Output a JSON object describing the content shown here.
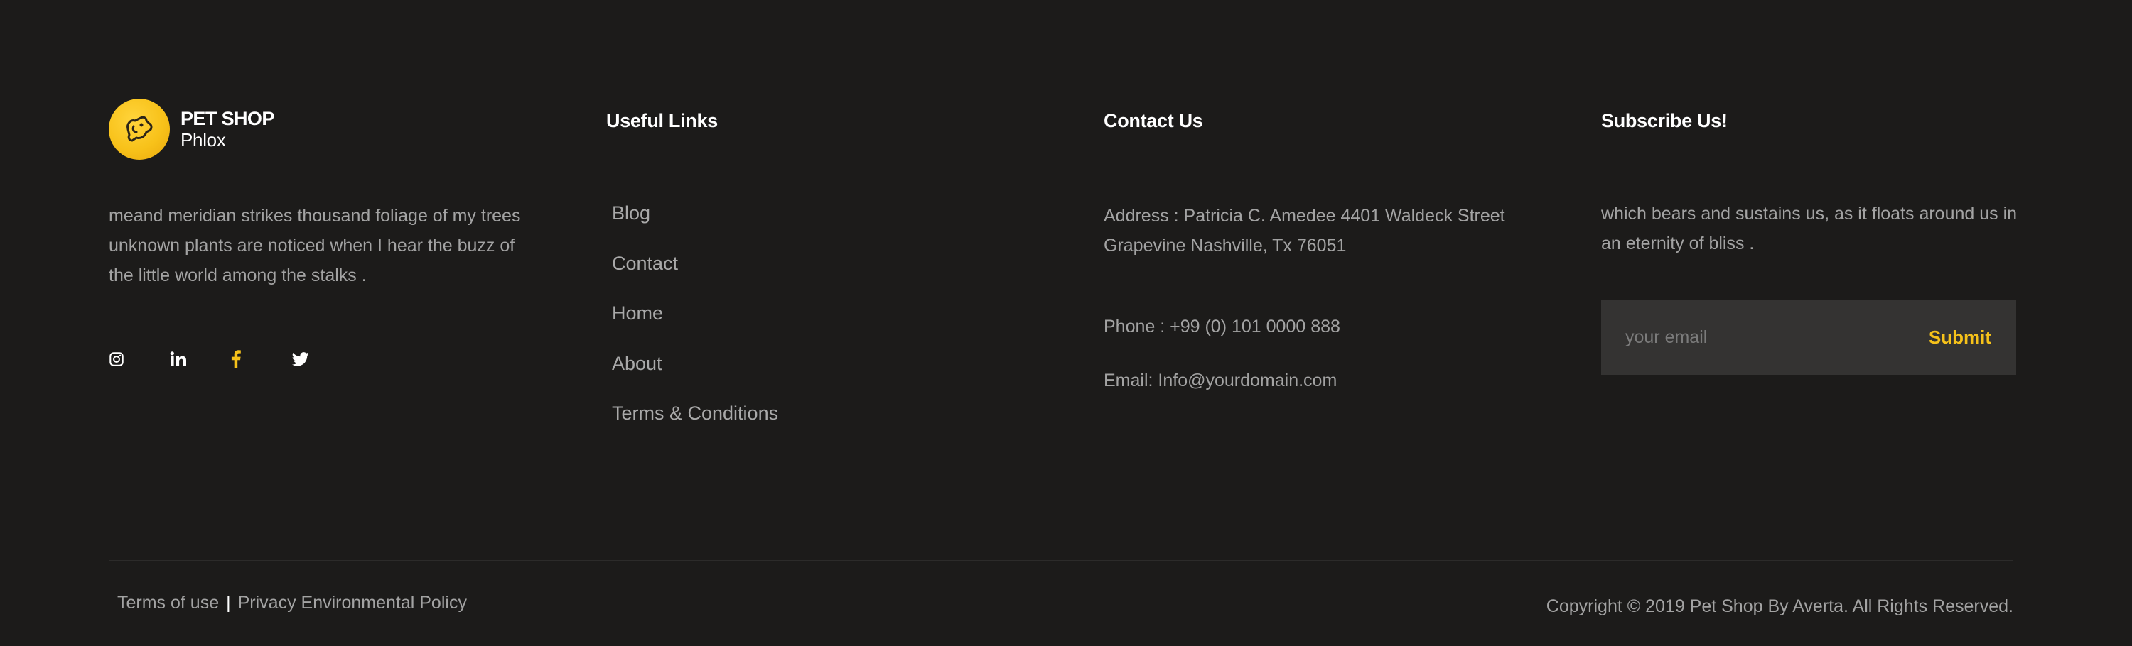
{
  "brand": {
    "title": "PET SHOP",
    "subtitle": "Phlox",
    "about": "meand meridian strikes thousand foliage of my trees unknown plants are noticed when I hear the buzz of the little world among the stalks .",
    "socials": [
      {
        "icon": "instagram-icon",
        "color": "#ffffff"
      },
      {
        "icon": "linkedin-icon",
        "color": "#ffffff"
      },
      {
        "icon": "facebook-icon",
        "color": "#f6c21a"
      },
      {
        "icon": "twitter-icon",
        "color": "#ffffff"
      }
    ],
    "logo_color": "#f8c21a"
  },
  "useful_links": {
    "heading": "Useful Links",
    "items": [
      "Blog",
      "Contact",
      "Home",
      "About",
      "Terms & Conditions"
    ]
  },
  "contact": {
    "heading": "Contact Us",
    "address": "Address : Patricia C. Amedee 4401 Waldeck Street Grapevine Nashville, Tx 76051",
    "phone": "Phone : +99 (0) 101 0000 888",
    "email": "Email: Info@yourdomain.com"
  },
  "subscribe": {
    "heading": "Subscribe Us!",
    "text": "which bears and sustains us, as it floats around us in an eternity of bliss .",
    "email_placeholder": "your email",
    "submit_label": "Submit",
    "accent": "#f6c21a"
  },
  "bottom": {
    "terms_label": "Terms of use",
    "separator": "|",
    "privacy_label": "Privacy Environmental Policy",
    "copyright": "Copyright © 2019 Pet Shop By Averta. All Rights Reserved."
  },
  "colors": {
    "background": "#1c1b1a",
    "input_background": "#343332",
    "text": "#a3a3a3",
    "heading": "#ffffff"
  }
}
